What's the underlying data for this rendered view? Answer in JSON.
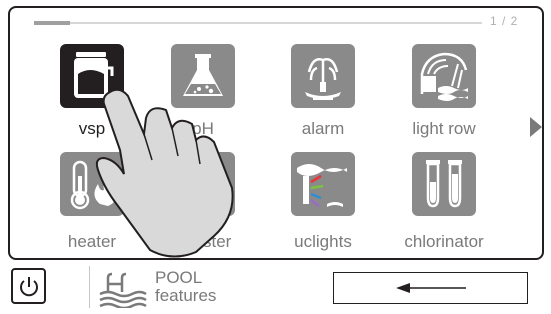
{
  "pager": {
    "indicator": "1 / 2",
    "progress_fraction": 0.08
  },
  "tiles": [
    {
      "label": "vsp",
      "icon": "vsp-pump-icon",
      "active": true
    },
    {
      "label": "pH",
      "icon": "flask-icon",
      "active": false
    },
    {
      "label": "alarm",
      "icon": "fountain-icon",
      "active": false
    },
    {
      "label": "light row",
      "icon": "waterfall-icon",
      "active": false
    },
    {
      "label": "heater",
      "icon": "thermometer-flame-icon",
      "active": false
    },
    {
      "label": "booster",
      "icon": "booster-icon",
      "active": false
    },
    {
      "label": "uclights",
      "icon": "underwater-lights-icon",
      "active": false
    },
    {
      "label": "chlorinator",
      "icon": "test-tubes-icon",
      "active": false
    }
  ],
  "footer": {
    "power_icon": "power-icon",
    "pool_icon": "pool-ladder-icon",
    "title_line1": "POOL",
    "title_line2": "features",
    "back_icon": "arrow-left-icon"
  },
  "colors": {
    "tile": "#8a8a8a",
    "tile_active": "#231f20",
    "text": "#7a7a7a",
    "border": "#231f20"
  }
}
